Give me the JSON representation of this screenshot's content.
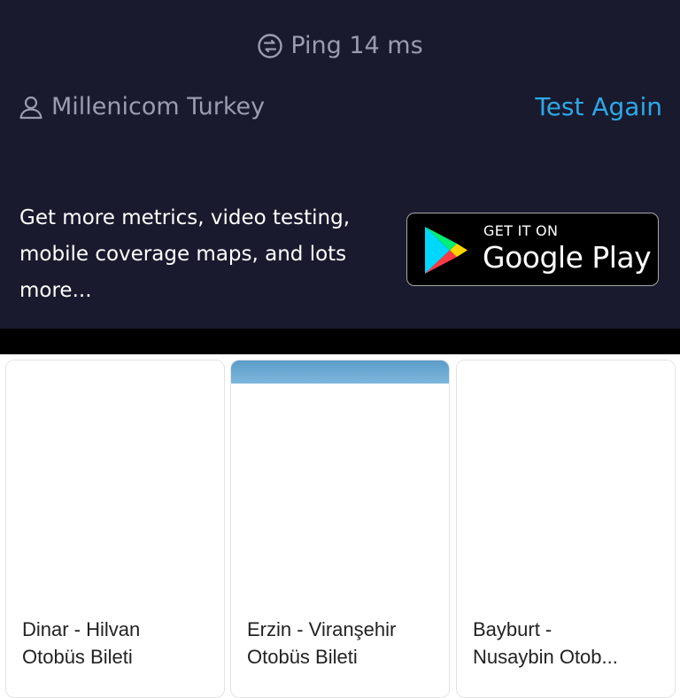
{
  "speedtest": {
    "ping_label": "Ping 14 ms",
    "isp": "Millenicom Turkey",
    "test_again": "Test Again",
    "promo_text": "Get more metrics, video testing, mobile coverage maps, and lots more...",
    "badge": {
      "small": "GET IT ON",
      "big": "Google Play"
    },
    "colors": {
      "panel_bg": "#191a2e",
      "muted_text": "#9a9cb0",
      "accent": "#2ea8e6"
    }
  },
  "cards": [
    {
      "line1": "Dinar - Hilvan",
      "line2": "Otobüs Bileti"
    },
    {
      "line1": "Erzin - Viranşehir",
      "line2": "Otobüs Bileti"
    },
    {
      "line1": "Bayburt -",
      "line2": "Nusaybin Otob..."
    }
  ]
}
